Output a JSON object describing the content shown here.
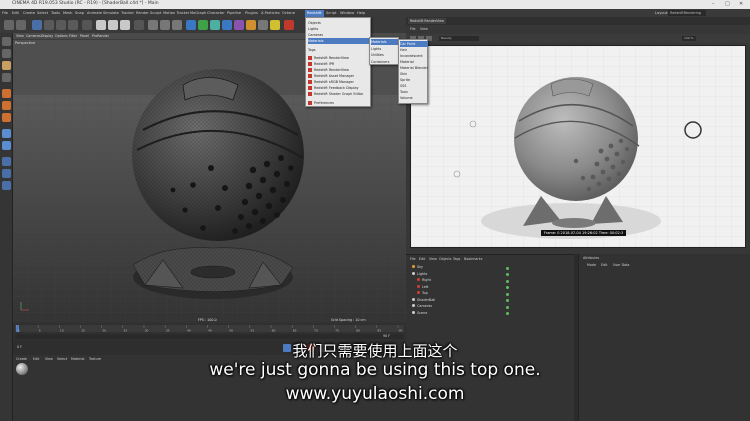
{
  "window": {
    "title": "CINEMA 4D R19.053 Studio (RC - R19) - [ShaderBall.c4d *] - Main",
    "controls": [
      "–",
      "□",
      "✕"
    ]
  },
  "menubar": {
    "items": [
      "File",
      "Edit",
      "Create",
      "Select",
      "Tools",
      "Mesh",
      "Snap",
      "Animate",
      "Simulate",
      "Tracker",
      "Render",
      "Sculpt",
      "Motion Tracker",
      "MoGraph",
      "Character",
      "Pipeline",
      "Plugins",
      "X-Particles",
      "Octane",
      "Redshift",
      "Script",
      "Window",
      "Help"
    ],
    "active": "Redshift",
    "layout_label": "Layout:",
    "layout_value": "RedshiftRendering (User)"
  },
  "redshift_menu": {
    "items": [
      "Objects",
      "Lights",
      "Cameras",
      "Materials",
      "Tags",
      "Redshift RenderView",
      "Redshift IPR",
      "Redshift RenderView",
      "Redshift Asset Manager",
      "Redshift sRGB Manager",
      "Redshift Feedback Display",
      "Redshift Shader Graph Editor",
      "Preferences"
    ],
    "highlighted": "Materials"
  },
  "materials_submenu": {
    "items": [
      "Materials",
      "Lights",
      "Utilities",
      "Containers"
    ]
  },
  "material_types_submenu": {
    "items": [
      "Car Paint",
      "Hair",
      "Incandescent",
      "Material",
      "Material Blender",
      "Skin",
      "Sprite",
      "SSS",
      "Toon",
      "Volume"
    ],
    "highlighted": "Car Paint"
  },
  "viewport": {
    "menu": [
      "View",
      "Cameras",
      "Display",
      "Options",
      "Filter",
      "Panel",
      "ProRender"
    ],
    "label": "Perspective",
    "fps": "FPS : 100.0",
    "grid": "Grid Spacing : 10 cm"
  },
  "timeline": {
    "ticks": [
      "0",
      "5",
      "10",
      "15",
      "20",
      "25",
      "30",
      "35",
      "40",
      "45",
      "50",
      "55",
      "60",
      "65",
      "70",
      "75",
      "80",
      "85",
      "90"
    ],
    "frame_start": "0 F",
    "frame_end": "90 F",
    "current": "0 F"
  },
  "material_manager": {
    "menu": [
      "Create",
      "Edit",
      "View",
      "Select",
      "Material",
      "Texture"
    ]
  },
  "renderview": {
    "tab": "Redshift RenderView",
    "menu": [
      "File",
      "View"
    ],
    "beauty": "Beauty",
    "zoom": "100 %",
    "stamp": "Frame: 0   2018-07-04  19:26:02  Time: 00:02:3"
  },
  "object_manager": {
    "menu": [
      "File",
      "Edit",
      "View",
      "Objects",
      "Tags",
      "Bookmarks"
    ],
    "rows": [
      {
        "name": "Sky",
        "indent": 0,
        "color": "#e0a030"
      },
      {
        "name": "Lights",
        "indent": 0,
        "color": "#cccccc"
      },
      {
        "name": "Right",
        "indent": 1,
        "color": "#d04030"
      },
      {
        "name": "Left",
        "indent": 1,
        "color": "#d04030"
      },
      {
        "name": "Top",
        "indent": 1,
        "color": "#d04030"
      },
      {
        "name": "ShaderBall",
        "indent": 0,
        "color": "#cccccc"
      },
      {
        "name": "Cameras",
        "indent": 0,
        "color": "#cccccc"
      },
      {
        "name": "Scene",
        "indent": 0,
        "color": "#cccccc"
      }
    ]
  },
  "attributes": {
    "tab": "Attributes",
    "menu": [
      "Mode",
      "Edit",
      "User Data"
    ]
  },
  "subtitles": {
    "cn": "我们只需要使用上面这个",
    "en": "we're just gonna be using this top one.",
    "url": "www.yuyulaoshi.com"
  },
  "colors": {
    "accent": "#4d7bc1",
    "panel": "#333333",
    "redshift_red": "#c0392b"
  }
}
